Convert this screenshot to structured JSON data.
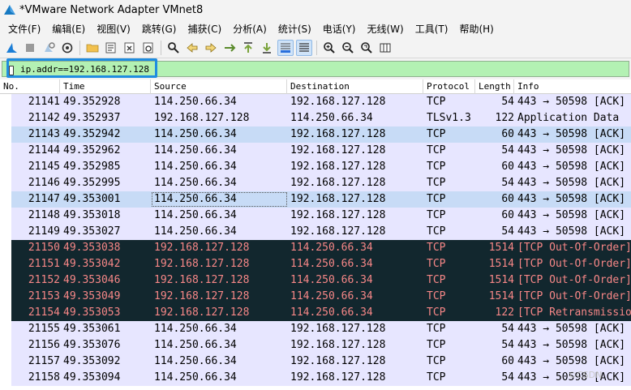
{
  "window": {
    "title": "*VMware Network Adapter VMnet8"
  },
  "menu": {
    "items": [
      "文件(F)",
      "编辑(E)",
      "视图(V)",
      "跳转(G)",
      "捕获(C)",
      "分析(A)",
      "统计(S)",
      "电话(Y)",
      "无线(W)",
      "工具(T)",
      "帮助(H)"
    ]
  },
  "toolbar": {
    "icons": [
      "shark-fin-start-icon",
      "stop-icon",
      "restart-icon",
      "options-gear-icon",
      "open-folder-icon",
      "save-file-icon",
      "close-file-icon",
      "reload-icon",
      "find-packet-icon",
      "go-back-icon",
      "go-forward-icon",
      "go-to-packet-icon",
      "go-first-icon",
      "go-last-icon",
      "autoscroll-icon",
      "colorize-icon",
      "zoom-in-icon",
      "zoom-out-icon",
      "zoom-normal-icon",
      "resize-columns-icon"
    ]
  },
  "filter": {
    "value": "ip.addr==192.168.127.128"
  },
  "columns": {
    "no": "No.",
    "time": "Time",
    "source": "Source",
    "destination": "Destination",
    "protocol": "Protocol",
    "length": "Length",
    "info": "Info"
  },
  "colors": {
    "row_lavender": "#e7e6ff",
    "row_selected": "#c7dbf6",
    "row_dark": "#12272e",
    "row_dark_text": "#f78787",
    "filter_bg": "#b3f1b3",
    "highlight_box": "#1f8de0"
  },
  "rows": [
    {
      "no": "21141",
      "time": "49.352928",
      "src": "114.250.66.34",
      "dst": "192.168.127.128",
      "proto": "TCP",
      "len": "54",
      "info": "443 → 50598 [ACK]",
      "style": "normal"
    },
    {
      "no": "21142",
      "time": "49.352937",
      "src": "192.168.127.128",
      "dst": "114.250.66.34",
      "proto": "TLSv1.3",
      "len": "122",
      "info": "Application Data",
      "style": "normal"
    },
    {
      "no": "21143",
      "time": "49.352942",
      "src": "114.250.66.34",
      "dst": "192.168.127.128",
      "proto": "TCP",
      "len": "60",
      "info": "443 → 50598 [ACK]",
      "style": "marked"
    },
    {
      "no": "21144",
      "time": "49.352962",
      "src": "114.250.66.34",
      "dst": "192.168.127.128",
      "proto": "TCP",
      "len": "54",
      "info": "443 → 50598 [ACK]",
      "style": "normal"
    },
    {
      "no": "21145",
      "time": "49.352985",
      "src": "114.250.66.34",
      "dst": "192.168.127.128",
      "proto": "TCP",
      "len": "60",
      "info": "443 → 50598 [ACK]",
      "style": "normal"
    },
    {
      "no": "21146",
      "time": "49.352995",
      "src": "114.250.66.34",
      "dst": "192.168.127.128",
      "proto": "TCP",
      "len": "54",
      "info": "443 → 50598 [ACK]",
      "style": "normal"
    },
    {
      "no": "21147",
      "time": "49.353001",
      "src": "114.250.66.34",
      "dst": "192.168.127.128",
      "proto": "TCP",
      "len": "60",
      "info": "443 → 50598 [ACK]",
      "style": "selected"
    },
    {
      "no": "21148",
      "time": "49.353018",
      "src": "114.250.66.34",
      "dst": "192.168.127.128",
      "proto": "TCP",
      "len": "60",
      "info": "443 → 50598 [ACK]",
      "style": "normal"
    },
    {
      "no": "21149",
      "time": "49.353027",
      "src": "114.250.66.34",
      "dst": "192.168.127.128",
      "proto": "TCP",
      "len": "54",
      "info": "443 → 50598 [ACK]",
      "style": "normal"
    },
    {
      "no": "21150",
      "time": "49.353038",
      "src": "192.168.127.128",
      "dst": "114.250.66.34",
      "proto": "TCP",
      "len": "1514",
      "info": "[TCP Out-Of-Order]",
      "style": "dark"
    },
    {
      "no": "21151",
      "time": "49.353042",
      "src": "192.168.127.128",
      "dst": "114.250.66.34",
      "proto": "TCP",
      "len": "1514",
      "info": "[TCP Out-Of-Order]",
      "style": "dark"
    },
    {
      "no": "21152",
      "time": "49.353046",
      "src": "192.168.127.128",
      "dst": "114.250.66.34",
      "proto": "TCP",
      "len": "1514",
      "info": "[TCP Out-Of-Order]",
      "style": "dark"
    },
    {
      "no": "21153",
      "time": "49.353049",
      "src": "192.168.127.128",
      "dst": "114.250.66.34",
      "proto": "TCP",
      "len": "1514",
      "info": "[TCP Out-Of-Order]",
      "style": "dark"
    },
    {
      "no": "21154",
      "time": "49.353053",
      "src": "192.168.127.128",
      "dst": "114.250.66.34",
      "proto": "TCP",
      "len": "122",
      "info": "[TCP Retransmission]",
      "style": "dark"
    },
    {
      "no": "21155",
      "time": "49.353061",
      "src": "114.250.66.34",
      "dst": "192.168.127.128",
      "proto": "TCP",
      "len": "54",
      "info": "443 → 50598 [ACK]",
      "style": "normal"
    },
    {
      "no": "21156",
      "time": "49.353076",
      "src": "114.250.66.34",
      "dst": "192.168.127.128",
      "proto": "TCP",
      "len": "54",
      "info": "443 → 50598 [ACK]",
      "style": "normal"
    },
    {
      "no": "21157",
      "time": "49.353092",
      "src": "114.250.66.34",
      "dst": "192.168.127.128",
      "proto": "TCP",
      "len": "60",
      "info": "443 → 50598 [ACK]",
      "style": "normal"
    },
    {
      "no": "21158",
      "time": "49.353094",
      "src": "114.250.66.34",
      "dst": "192.168.127.128",
      "proto": "TCP",
      "len": "54",
      "info": "443 → 50598 [ACK]",
      "style": "normal"
    }
  ],
  "watermark": "©CSDN"
}
